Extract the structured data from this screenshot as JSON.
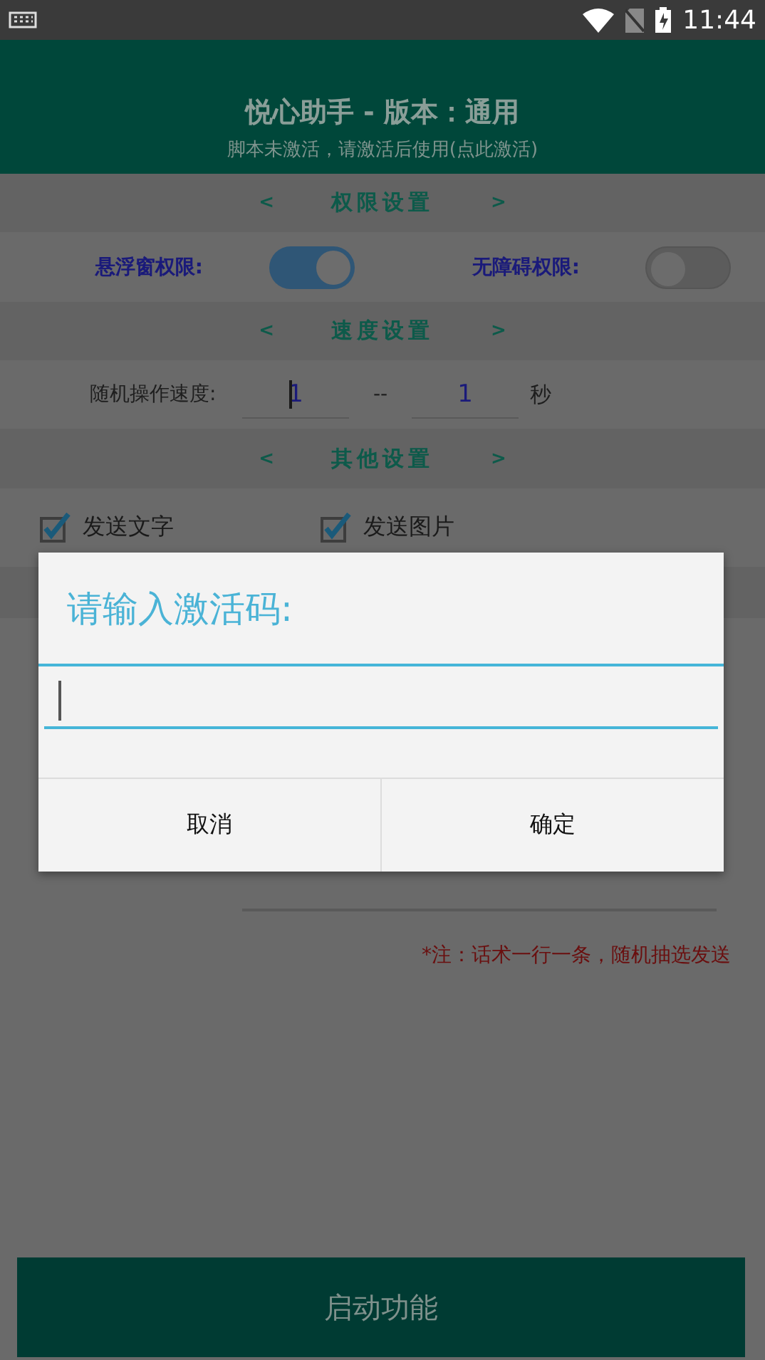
{
  "status_bar": {
    "time": "11:44"
  },
  "header": {
    "title": "悦心助手 - 版本：通用",
    "subtitle": "脚本未激活，请激活后使用(点此激活)"
  },
  "permissions": {
    "heading": {
      "prev": "<",
      "title": "权限设置",
      "next": ">"
    },
    "toggles": [
      {
        "label": "悬浮窗权限:",
        "on": true
      },
      {
        "label": "无障碍权限:",
        "on": false
      }
    ]
  },
  "speed": {
    "heading": {
      "prev": "<",
      "title": "速度设置",
      "next": ">"
    },
    "label": "随机操作速度:",
    "min": "1",
    "dash": "--",
    "max": "1",
    "unit": "秒"
  },
  "other": {
    "heading": {
      "prev": "<",
      "title": "其他设置",
      "next": ">"
    },
    "checkboxes": [
      {
        "label": "发送文字",
        "checked": true
      },
      {
        "label": "发送图片",
        "checked": true
      }
    ]
  },
  "note": "*注：话术一行一条，随机抽选发送",
  "start_button": "启动功能",
  "dialog": {
    "title": "请输入激活码:",
    "buttons": [
      "取消",
      "确定"
    ]
  }
}
